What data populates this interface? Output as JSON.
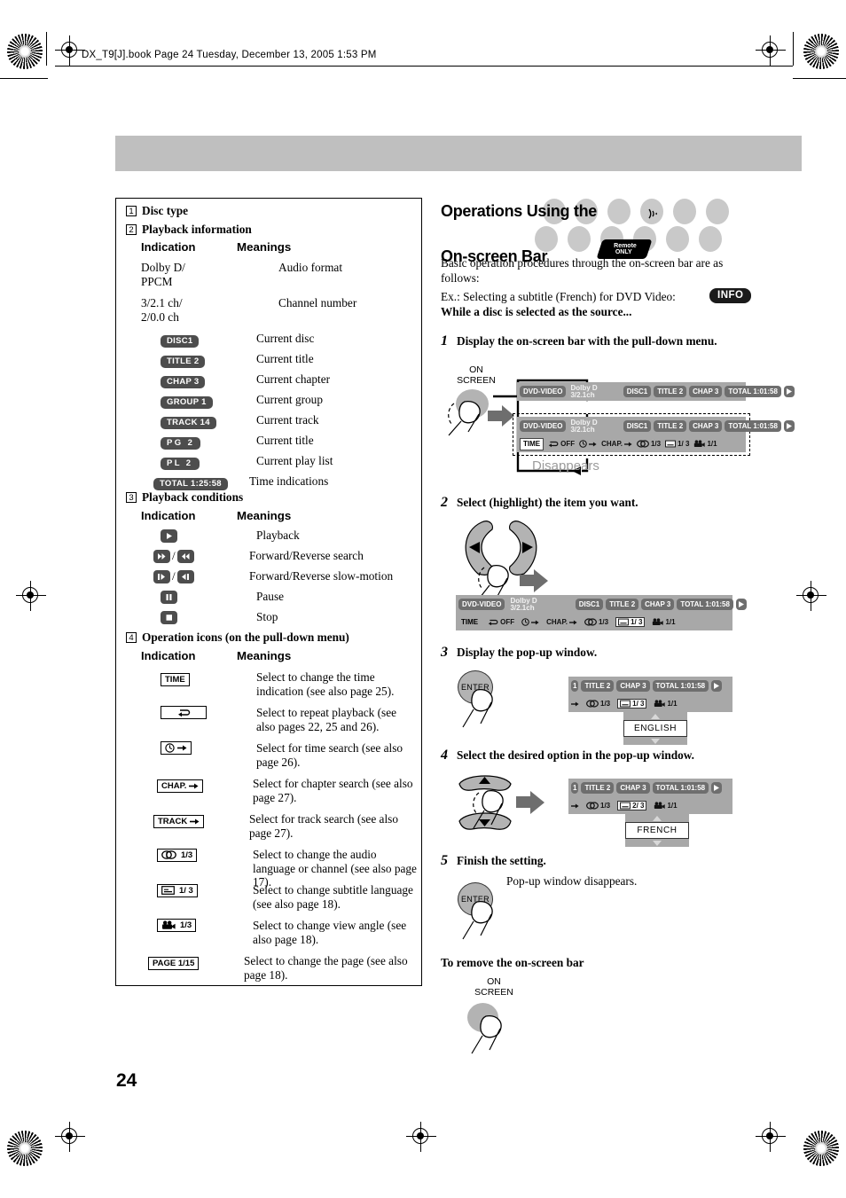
{
  "page": {
    "running_head": "DX_T9[J].book  Page 24  Tuesday, December 13, 2005  1:53 PM",
    "page_number": "24"
  },
  "left_table": {
    "sections": [
      {
        "num": "1",
        "title": "Disc type"
      },
      {
        "num": "2",
        "title": "Playback information"
      },
      {
        "num": "3",
        "title": "Playback conditions"
      },
      {
        "num": "4",
        "title": "Operation icons (on the pull-down menu)"
      }
    ],
    "col_indication": "Indication",
    "col_meanings": "Meanings",
    "playback_information": [
      {
        "indication": "Dolby D/\nPPCM",
        "kind": "text",
        "meaning": "Audio format"
      },
      {
        "indication": "3/2.1 ch/\n2/0.0 ch",
        "kind": "text",
        "meaning": "Channel number"
      },
      {
        "indication": "DISC1",
        "kind": "pill",
        "meaning": "Current disc"
      },
      {
        "indication": "TITLE  2",
        "kind": "pill",
        "meaning": "Current title"
      },
      {
        "indication": "CHAP  3",
        "kind": "pill",
        "meaning": "Current chapter"
      },
      {
        "indication": "GROUP 1",
        "kind": "pill",
        "meaning": "Current group"
      },
      {
        "indication": "TRACK 14",
        "kind": "pill",
        "meaning": "Current track"
      },
      {
        "indication": "PG      2",
        "kind": "pill",
        "meaning": "Current title"
      },
      {
        "indication": "PL      2",
        "kind": "pill",
        "meaning": "Current play list"
      },
      {
        "indication": "TOTAL 1:25:58",
        "kind": "pill",
        "meaning": "Time indications"
      }
    ],
    "playback_conditions": [
      {
        "icon": "play-icon",
        "meaning": "Playback"
      },
      {
        "icon": "fast-forward-rewind-icon",
        "meaning": "Forward/Reverse search"
      },
      {
        "icon": "slow-motion-icon",
        "meaning": "Forward/Reverse slow-motion"
      },
      {
        "icon": "pause-icon",
        "meaning": "Pause"
      },
      {
        "icon": "stop-icon",
        "meaning": "Stop"
      }
    ],
    "operation_icons": [
      {
        "label": "TIME",
        "icon": "time-icon",
        "meaning": "Select to change the time indication (see also page 25)."
      },
      {
        "label": "",
        "icon": "repeat-icon",
        "meaning": "Select to repeat playback (see also pages 22, 25 and 26)."
      },
      {
        "label": "",
        "icon": "time-search-icon",
        "meaning": "Select for time search (see also page 26)."
      },
      {
        "label": "CHAP.",
        "icon": "chapter-search-icon",
        "meaning": "Select for chapter search (see also page 27)."
      },
      {
        "label": "TRACK",
        "icon": "track-search-icon",
        "meaning": "Select for track search (see also page 27)."
      },
      {
        "label": "1/3",
        "icon": "audio-language-icon",
        "meaning": "Select to change the audio language or channel (see also page 17)."
      },
      {
        "label": "1/ 3",
        "icon": "subtitle-icon",
        "meaning": "Select to change subtitle language (see also page 18)."
      },
      {
        "label": "1/3",
        "icon": "view-angle-icon",
        "meaning": "Select to change view angle (see also page 18)."
      },
      {
        "label": "PAGE 1/15",
        "icon": "page-icon",
        "meaning": "Select to change the page (see also page 18)."
      }
    ]
  },
  "right": {
    "title_line1": "Operations Using the",
    "title_line2": "On-screen Bar",
    "remote_badge_line1": "Remote",
    "remote_badge_line2": "ONLY",
    "info_badge": "INFO",
    "intro_1": "Basic operation procedures through the on-screen bar are as follows:",
    "intro_2": "Ex.: Selecting a subtitle (French) for DVD Video:",
    "intro_bold": "While a disc is selected as the source...",
    "steps": [
      {
        "num": "1",
        "text": "Display the on-screen bar with the pull-down menu."
      },
      {
        "num": "2",
        "text": "Select (highlight) the item you want."
      },
      {
        "num": "3",
        "text": "Display the pop-up window."
      },
      {
        "num": "4",
        "text": "Select the desired option in the pop-up window."
      },
      {
        "num": "5",
        "text": "Finish the setting."
      }
    ],
    "on_screen_button_label": "ON\nSCREEN",
    "on_screen_label_line1": "ON",
    "on_screen_label_line2": "SCREEN",
    "enter_button_label": "ENTER",
    "disappears_label": "Disappears",
    "popup_disappears_note": "Pop-up window disappears.",
    "remove_heading": "To remove the on-screen bar"
  },
  "osd": {
    "disc_type": "DVD-VIDEO",
    "audio_format_line1": "Dolby D",
    "audio_format_line2": "3/2.1ch",
    "disc": "DISC1",
    "title": "TITLE  2",
    "chapter": "CHAP  3",
    "total_time": "TOTAL  1:01:58",
    "menu": {
      "time": "TIME",
      "repeat": "OFF",
      "chapter_search": "CHAP.",
      "audio": "1/3",
      "subtitle": "1/ 3",
      "angle": "1/1"
    },
    "step4_subtitle": "2/ 3",
    "popup_english": "ENGLISH",
    "popup_french": "FRENCH"
  }
}
